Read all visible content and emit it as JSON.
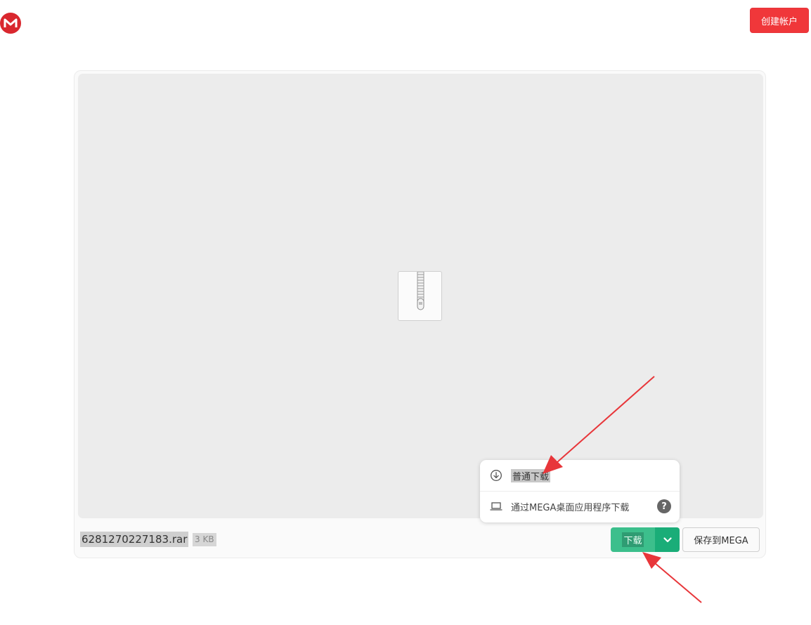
{
  "header": {
    "logo_icon": "mega-logo-icon",
    "create_account_label": "创建帐户"
  },
  "file": {
    "name": "6281270227183.rar",
    "size": "3 KB",
    "preview_icon": "zip-archive-icon"
  },
  "actions": {
    "download_label": "下载",
    "dropdown_icon": "chevron-down-icon",
    "save_label": "保存到MEGA"
  },
  "download_menu": {
    "items": [
      {
        "label": "普通下载",
        "icon": "download-circle-icon"
      },
      {
        "label": "通过MEGA桌面应用程序下载",
        "icon": "laptop-icon",
        "help_icon": "help-icon",
        "help_glyph": "?"
      }
    ]
  },
  "colors": {
    "brand": "#d9272e",
    "create_button": "#f0373a",
    "download_button": "#3cbf8c",
    "annotation_arrow": "#e8363a"
  }
}
